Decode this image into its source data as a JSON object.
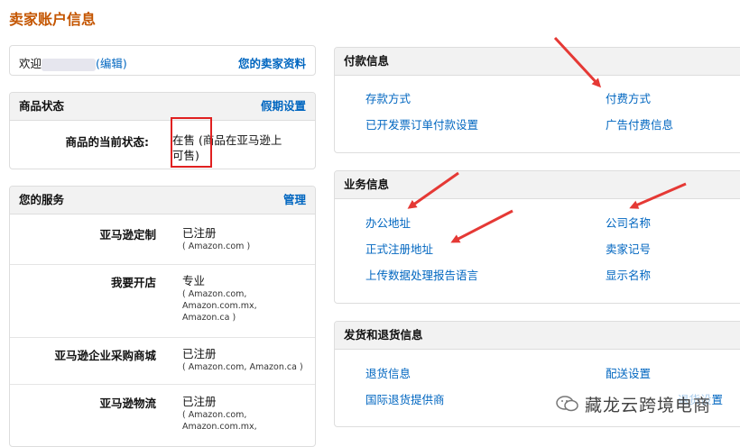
{
  "page": {
    "title": "卖家账户信息"
  },
  "welcome": {
    "prefix": "欢迎",
    "edit": "(编辑)",
    "profile_link": "您的卖家资料"
  },
  "status": {
    "header": "商品状态",
    "holiday": "假期设置",
    "label": "商品的当前状态:",
    "value_line1": "在售 (商品在亚马逊上",
    "value_line2": "可售)"
  },
  "services": {
    "header": "您的服务",
    "manage": "管理",
    "items": [
      {
        "label": "亚马逊定制",
        "value": "已注册",
        "note": "( Amazon.com )"
      },
      {
        "label": "我要开店",
        "value": "专业",
        "note": "( Amazon.com,\nAmazon.com.mx,\nAmazon.ca )"
      },
      {
        "label": "亚马逊企业采购商城",
        "value": "已注册",
        "note": "( Amazon.com, Amazon.ca )"
      },
      {
        "label": "亚马逊物流",
        "value": "已注册",
        "note": "( Amazon.com,\nAmazon.com.mx,"
      }
    ]
  },
  "payment": {
    "header": "付款信息",
    "links": [
      "存款方式",
      "付费方式",
      "已开发票订单付款设置",
      "广告付费信息"
    ]
  },
  "business": {
    "header": "业务信息",
    "links": [
      "办公地址",
      "公司名称",
      "正式注册地址",
      "卖家记号",
      "上传数据处理报告语言",
      "显示名称"
    ]
  },
  "shipping": {
    "header": "发货和退货信息",
    "links": [
      "退货信息",
      "配送设置",
      "国际退货提供商",
      "退货设置"
    ]
  },
  "watermark": {
    "text": "藏龙云跨境电商"
  },
  "colors": {
    "link": "#0066c0",
    "title": "#c45500",
    "highlight": "#e02020",
    "arrow": "#e53935"
  }
}
